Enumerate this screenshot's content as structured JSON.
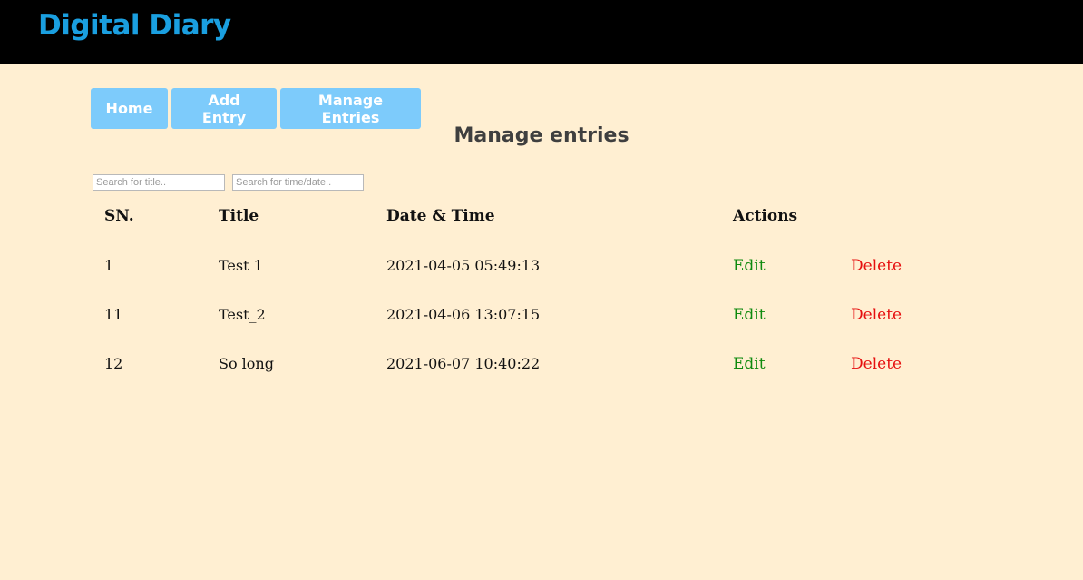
{
  "header": {
    "brand": "Digital Diary",
    "background": "#000000",
    "brand_color": "#1a9fe0"
  },
  "nav": {
    "items": [
      {
        "label": "Home"
      },
      {
        "label": "Add Entry"
      },
      {
        "label": "Manage Entries"
      }
    ],
    "button_color": "#7dcbfb"
  },
  "page": {
    "title": "Manage entries",
    "background": "#ffefd2"
  },
  "search": {
    "title_placeholder": "Search for title..",
    "time_placeholder": "Search for time/date.."
  },
  "table": {
    "columns": [
      "SN.",
      "Title",
      "Date & Time",
      "Actions"
    ],
    "rows": [
      {
        "sn": "1",
        "title": "Test 1",
        "datetime": "2021-04-05 05:49:13",
        "edit": "Edit",
        "delete": "Delete"
      },
      {
        "sn": "11",
        "title": "Test_2",
        "datetime": "2021-04-06 13:07:15",
        "edit": "Edit",
        "delete": "Delete"
      },
      {
        "sn": "12",
        "title": "So long",
        "datetime": "2021-06-07 10:40:22",
        "edit": "Edit",
        "delete": "Delete"
      }
    ],
    "edit_color": "#0e8a0e",
    "delete_color": "#e60f0f"
  }
}
